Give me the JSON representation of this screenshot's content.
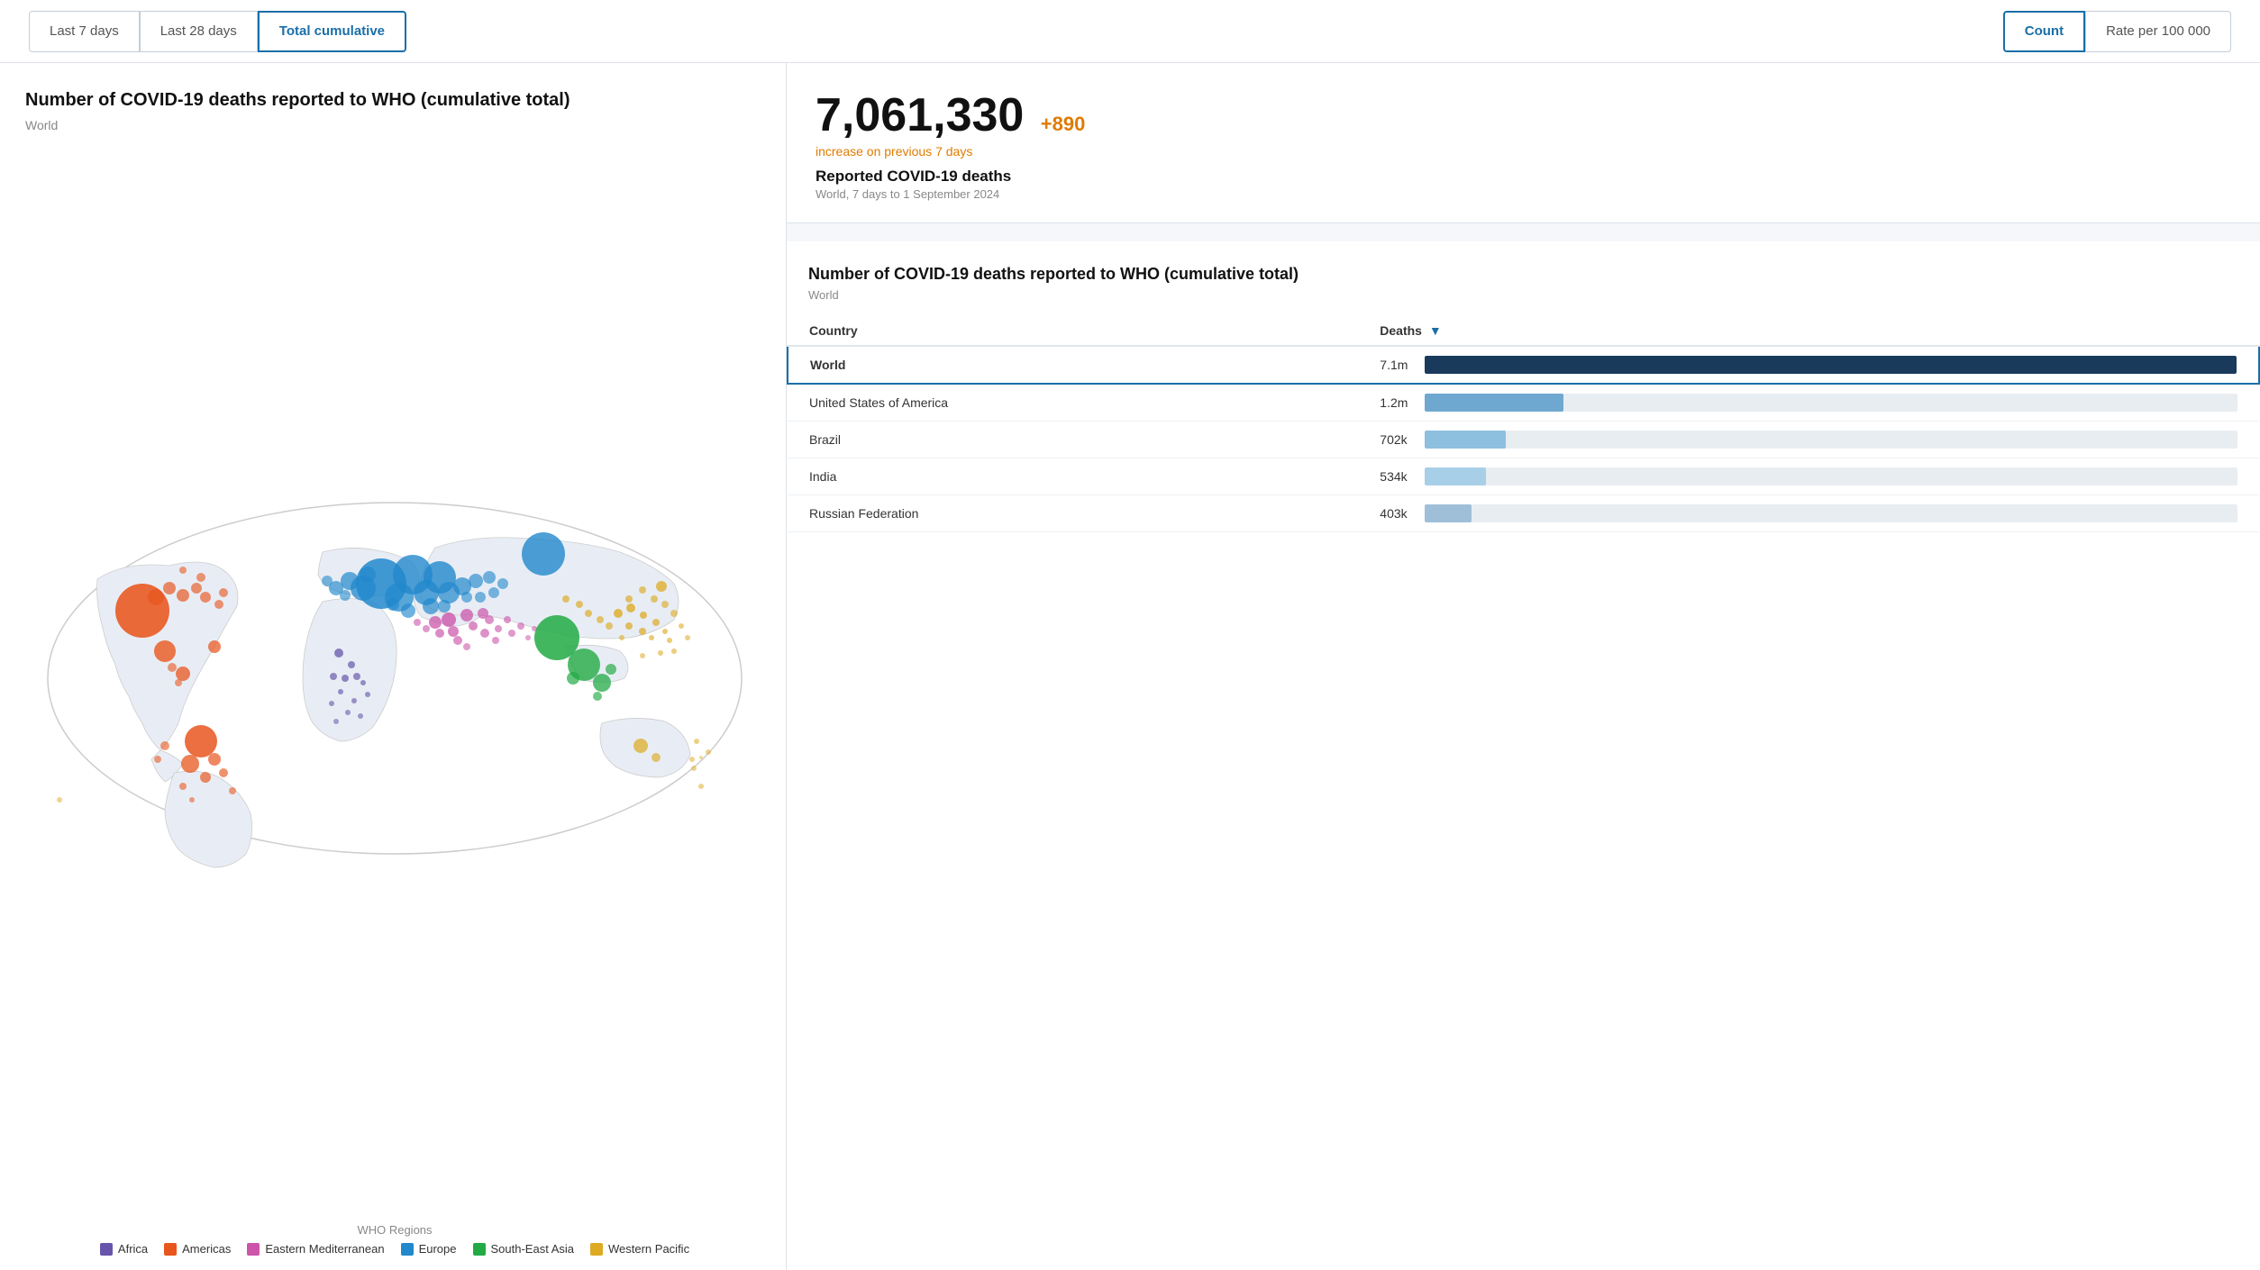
{
  "toolbar": {
    "tabs": [
      {
        "id": "last7",
        "label": "Last 7 days",
        "active": false
      },
      {
        "id": "last28",
        "label": "Last 28 days",
        "active": false
      },
      {
        "id": "cumulative",
        "label": "Total cumulative",
        "active": true
      }
    ],
    "metrics": [
      {
        "id": "count",
        "label": "Count",
        "active": true
      },
      {
        "id": "rate",
        "label": "Rate per 100 000",
        "active": false
      }
    ]
  },
  "chart": {
    "title": "Number of COVID-19 deaths reported to WHO (cumulative total)",
    "subtitle": "World",
    "legend_title": "WHO Regions",
    "legend_items": [
      {
        "label": "Africa",
        "color": "#6655aa"
      },
      {
        "label": "Americas",
        "color": "#e8561e"
      },
      {
        "label": "Eastern Mediterranean",
        "color": "#cc55aa"
      },
      {
        "label": "Europe",
        "color": "#2288cc"
      },
      {
        "label": "South-East Asia",
        "color": "#22aa44"
      },
      {
        "label": "Western Pacific",
        "color": "#ddaa22"
      }
    ]
  },
  "stats": {
    "big_number": "7,061,330",
    "change": "+890",
    "change_label": "increase on previous 7 days",
    "label": "Reported COVID-19 deaths",
    "meta": "World, 7 days to 1 September 2024"
  },
  "table": {
    "title": "Number of COVID-19 deaths reported to WHO (cumulative total)",
    "region": "World",
    "col_country": "Country",
    "col_deaths": "Deaths",
    "rows": [
      {
        "country": "World",
        "deaths": "7.1m",
        "bar_pct": 100,
        "bar_class": "world",
        "is_world": true
      },
      {
        "country": "United States of America",
        "deaths": "1.2m",
        "bar_pct": 17,
        "bar_class": "usa",
        "is_world": false
      },
      {
        "country": "Brazil",
        "deaths": "702k",
        "bar_pct": 10,
        "bar_class": "brazil",
        "is_world": false
      },
      {
        "country": "India",
        "deaths": "534k",
        "bar_pct": 7.5,
        "bar_class": "india",
        "is_world": false
      },
      {
        "country": "Russian Federation",
        "deaths": "403k",
        "bar_pct": 5.7,
        "bar_class": "russia",
        "is_world": false
      }
    ]
  }
}
